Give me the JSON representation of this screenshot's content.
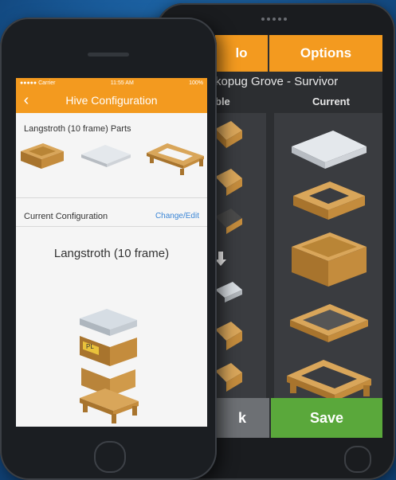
{
  "tablet": {
    "tab_left_label": "lo",
    "tab_right_label": "Options",
    "config_title": "kopug Grove - Survivor",
    "col_left_header": "ble",
    "col_right_header": "Current",
    "bottom_left_label": "k",
    "save_label": "Save"
  },
  "phone": {
    "status_left": "●●●●● Carrier",
    "status_center": "11:55 AM",
    "status_right": "100%",
    "nav_title": "Hive Configuration",
    "parts_label": "Langstroth (10 frame) Parts",
    "current_label": "Current Configuration",
    "change_link": "Change/Edit",
    "config_name": "Langstroth (10 frame)",
    "hive_tag": "PL"
  },
  "colors": {
    "accent": "#f39a1f",
    "save": "#5aa83b",
    "link": "#3b86d6"
  }
}
